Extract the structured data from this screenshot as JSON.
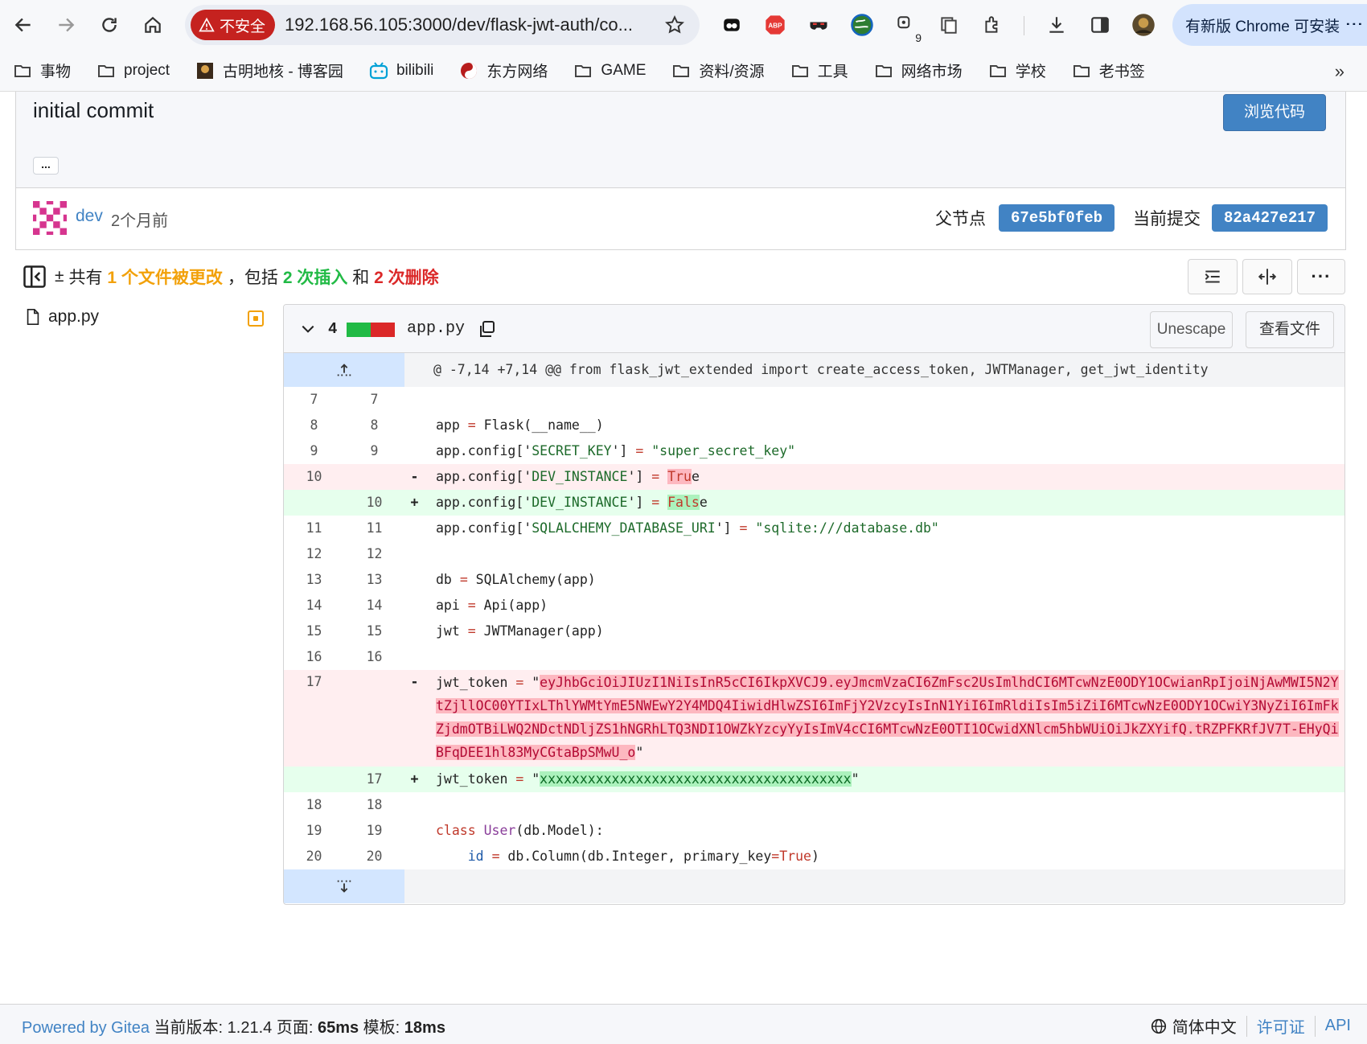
{
  "browser": {
    "insecure_label": "不安全",
    "url": "192.168.56.105:3000/dev/flask-jwt-auth/co...",
    "update_label": "有新版 Chrome 可安装",
    "ext_badge": "9"
  },
  "bookmarks": [
    {
      "label": "事物",
      "icon": "folder-icon"
    },
    {
      "label": "project",
      "icon": "folder-icon"
    },
    {
      "label": "古明地核 - 博客园",
      "icon": "site-icon"
    },
    {
      "label": "bilibili",
      "icon": "bilibili-icon"
    },
    {
      "label": "东方网络",
      "icon": "yinyang-icon"
    },
    {
      "label": "GAME",
      "icon": "folder-icon"
    },
    {
      "label": "资料/资源",
      "icon": "folder-icon"
    },
    {
      "label": "工具",
      "icon": "folder-icon"
    },
    {
      "label": "网络市场",
      "icon": "folder-icon"
    },
    {
      "label": "学校",
      "icon": "folder-icon"
    },
    {
      "label": "老书签",
      "icon": "folder-icon"
    }
  ],
  "commit": {
    "title": "initial commit",
    "ellipsis": "...",
    "browse_label": "浏览代码",
    "author": "dev",
    "time": "2个月前",
    "parent_label": "父节点",
    "parent_sha": "67e5bf0feb",
    "current_label": "当前提交",
    "current_sha": "82a427e217"
  },
  "stats": {
    "prefix": "共有",
    "files": "1 个文件被更改",
    "mid": "，包括",
    "insertions": "2 次插入",
    "and": "和",
    "deletions": "2 次删除"
  },
  "file_tree": [
    {
      "name": "app.py"
    }
  ],
  "diff": {
    "count": "4",
    "filename": "app.py",
    "unescape_label": "Unescape",
    "view_file_label": "查看文件",
    "hunk": "@ -7,14 +7,14 @@ from flask_jwt_extended import create_access_token, JWTManager, get_jwt_identity",
    "lines": [
      {
        "old": "7",
        "new": "7",
        "sign": "",
        "code": ""
      },
      {
        "old": "8",
        "new": "8",
        "sign": "",
        "code": "app = Flask(__name__)"
      },
      {
        "old": "9",
        "new": "9",
        "sign": "",
        "code": "app.config['SECRET_KEY'] = \"super_secret_key\""
      },
      {
        "old": "10",
        "new": "",
        "sign": "-",
        "code": "app.config['DEV_INSTANCE'] = True"
      },
      {
        "old": "",
        "new": "10",
        "sign": "+",
        "code": "app.config['DEV_INSTANCE'] = False"
      },
      {
        "old": "11",
        "new": "11",
        "sign": "",
        "code": "app.config['SQLALCHEMY_DATABASE_URI'] = \"sqlite:///database.db\""
      },
      {
        "old": "12",
        "new": "12",
        "sign": "",
        "code": ""
      },
      {
        "old": "13",
        "new": "13",
        "sign": "",
        "code": "db = SQLAlchemy(app)"
      },
      {
        "old": "14",
        "new": "14",
        "sign": "",
        "code": "api = Api(app)"
      },
      {
        "old": "15",
        "new": "15",
        "sign": "",
        "code": "jwt = JWTManager(app)"
      },
      {
        "old": "16",
        "new": "16",
        "sign": "",
        "code": ""
      },
      {
        "old": "17",
        "new": "",
        "sign": "-",
        "code_prefix": "jwt_token = \"",
        "token": "eyJhbGciOiJIUzI1NiIsInR5cCI6IkpXVCJ9.eyJmcmVzaCI6ZmFsc2UsImlhdCI6MTcwNzE0ODY1OCwianRpIjoiNjAwMWI5N2YtZjllOC00YTIxLThlYWMtYmE5NWEwY2Y4MDQ4IiwidHlwZSI6ImFjY2VzcyIsInN1YiI6ImRldiIsIm5iZiI6MTcwNzE0ODY1OCwiY3NyZiI6ImFkZjdmOTBiLWQ2NDctNDljZS1hNGRhLTQ3NDI1OWZkYzcyYyIsImV4cCI6MTcwNzE0OTI1OCwidXNlcm5hbWUiOiJkZXYifQ.tRZPFKRfJV7T-EHyQiBFqDEE1hl83MyCGtaBpSMwU_o",
        "code_suffix": "\""
      },
      {
        "old": "",
        "new": "17",
        "sign": "+",
        "code_prefix": "jwt_token = \"",
        "token": "xxxxxxxxxxxxxxxxxxxxxxxxxxxxxxxxxxxxxxx",
        "code_suffix": "\""
      },
      {
        "old": "18",
        "new": "18",
        "sign": "",
        "code": ""
      },
      {
        "old": "19",
        "new": "19",
        "sign": "",
        "code": "class User(db.Model):"
      },
      {
        "old": "20",
        "new": "20",
        "sign": "",
        "code": "    id = db.Column(db.Integer, primary_key=True)"
      }
    ]
  },
  "footer": {
    "powered_by": "Powered by Gitea",
    "version_label": "当前版本: 1.21.4 页面:",
    "page_time": "65ms",
    "template_label": "模板:",
    "template_time": "18ms",
    "language": "简体中文",
    "license": "许可证",
    "api": "API"
  },
  "colors": {
    "accent": "#4183c4",
    "added": "#21ba45",
    "deleted": "#db2828",
    "changed": "#f2a10a"
  }
}
